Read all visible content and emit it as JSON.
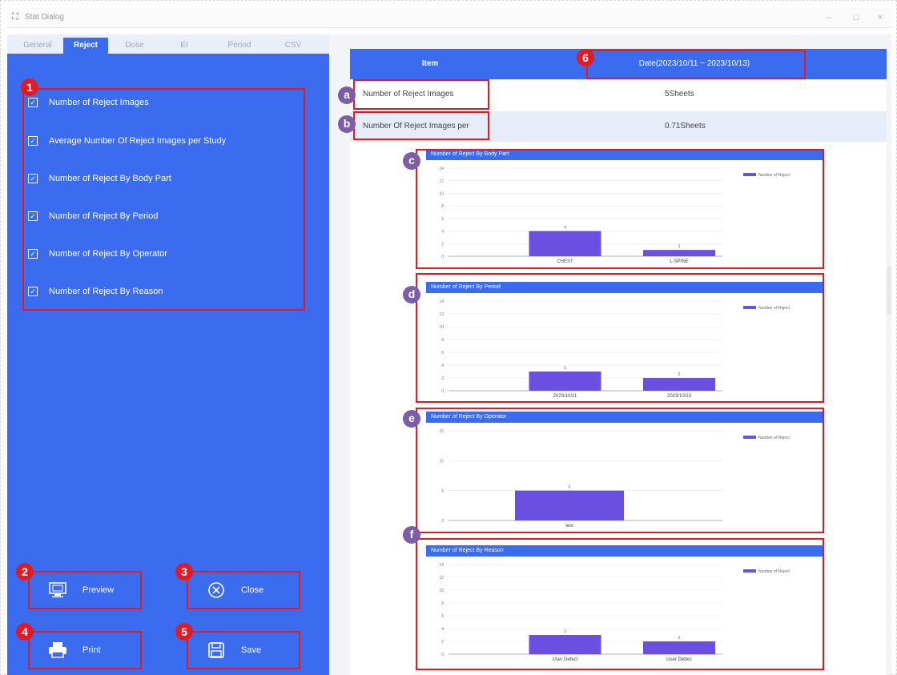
{
  "window": {
    "title": "Stat Dialog",
    "minimize": "–",
    "maximize": "□",
    "close": "×"
  },
  "tabs": [
    {
      "label": "General",
      "active": false
    },
    {
      "label": "Reject",
      "active": true
    },
    {
      "label": "Dose",
      "active": false
    },
    {
      "label": "EI",
      "active": false
    },
    {
      "label": "Period",
      "active": false
    },
    {
      "label": "CSV",
      "active": false
    }
  ],
  "options": [
    {
      "label": "Number of Reject Images",
      "checked": true
    },
    {
      "label": "Average Number Of Reject Images per Study",
      "checked": true
    },
    {
      "label": "Number of Reject By Body Part",
      "checked": true
    },
    {
      "label": "Number of Reject By Period",
      "checked": true
    },
    {
      "label": "Number of Reject By Operator",
      "checked": true
    },
    {
      "label": "Number of Reject By Reason",
      "checked": true
    }
  ],
  "buttons": {
    "preview": "Preview",
    "close": "Close",
    "print": "Print",
    "save": "Save"
  },
  "badges": {
    "options": "1",
    "preview": "2",
    "close": "3",
    "print": "4",
    "save": "5",
    "date": "6",
    "a": "a",
    "b": "b",
    "c": "c",
    "d": "d",
    "e": "e",
    "f": "f"
  },
  "report": {
    "header_item": "Item",
    "header_date": "Date(2023/10/11 ~ 2023/10/13)",
    "rows": [
      {
        "label": "Number of Reject Images",
        "value": "5Sheets"
      },
      {
        "label": "Number Of Reject Images per",
        "value": "0.71Sheets"
      }
    ]
  },
  "colors": {
    "accent": "#3b6cf0",
    "bar": "#6a4fe0",
    "highlight": "#e01b24",
    "step_badge": "#7b5ea7"
  },
  "chart_data": [
    {
      "type": "bar",
      "title": "Number of Reject By Body Part",
      "categories": [
        "CHEST",
        "L-SPINE"
      ],
      "series": [
        {
          "name": "Number of Reject",
          "values": [
            4,
            1
          ]
        }
      ],
      "value_labels": [
        "4",
        "1"
      ],
      "ylim": [
        0,
        14
      ],
      "yticks": [
        0,
        2,
        4,
        6,
        8,
        10,
        12,
        14
      ],
      "legend": "top-right"
    },
    {
      "type": "bar",
      "title": "Number of Reject By Period",
      "categories": [
        "2023/10/11",
        "2023/10/13"
      ],
      "series": [
        {
          "name": "Number of Reject",
          "values": [
            3,
            2
          ]
        }
      ],
      "value_labels": [
        "3",
        "2"
      ],
      "ylim": [
        0,
        14
      ],
      "yticks": [
        0,
        2,
        4,
        6,
        8,
        10,
        12,
        14
      ],
      "legend": "top-right"
    },
    {
      "type": "bar",
      "title": "Number of Reject By Operator",
      "categories": [
        "test"
      ],
      "series": [
        {
          "name": "Number of Reject",
          "values": [
            5
          ]
        }
      ],
      "value_labels": [
        "5"
      ],
      "ylim": [
        0,
        15
      ],
      "yticks": [
        0,
        5,
        10,
        15
      ],
      "legend": "top-right"
    },
    {
      "type": "bar",
      "title": "Number of Reject By Reason",
      "categories": [
        "User Defect",
        "User Defect"
      ],
      "series": [
        {
          "name": "Number of Reject",
          "values": [
            3,
            2
          ]
        }
      ],
      "value_labels": [
        "3",
        "2"
      ],
      "ylim": [
        0,
        14
      ],
      "yticks": [
        0,
        2,
        4,
        6,
        8,
        10,
        12,
        14
      ],
      "legend": "top-right"
    }
  ]
}
